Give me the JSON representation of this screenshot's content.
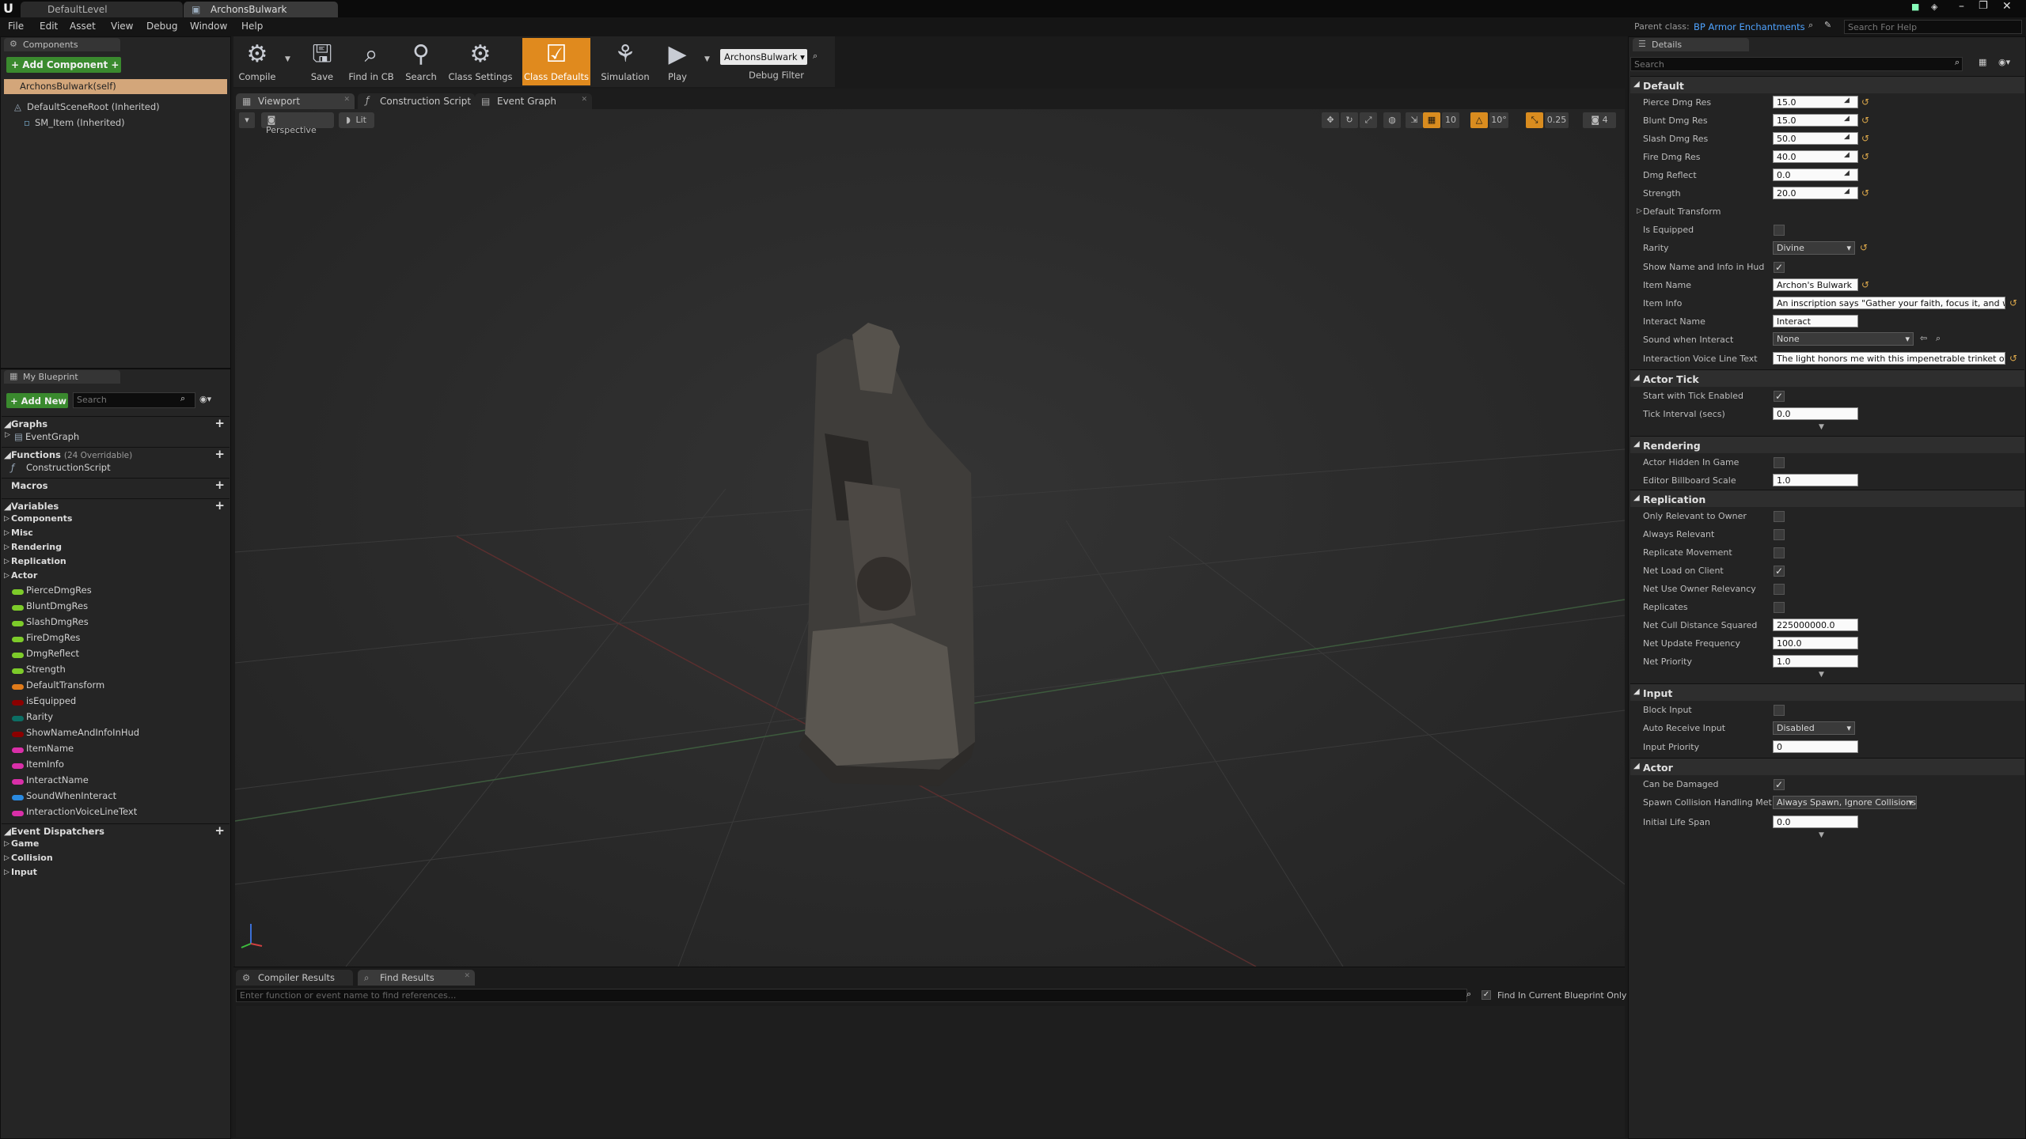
{
  "titlebar": {
    "tabs": [
      "DefaultLevel",
      "ArchonsBulwark"
    ]
  },
  "menubar": {
    "items": [
      "File",
      "Edit",
      "Asset",
      "View",
      "Debug",
      "Window",
      "Help"
    ],
    "parent_class_label": "Parent class:",
    "parent_class_value": "BP Armor Enchantments",
    "search_help_placeholder": "Search For Help"
  },
  "toolbar": {
    "buttons": [
      "Compile",
      "Save",
      "Find in CB",
      "Search",
      "Class Settings",
      "Class Defaults",
      "Simulation",
      "Play"
    ],
    "debug_object": "ArchonsBulwark",
    "debug_filter": "Debug Filter"
  },
  "components": {
    "tab": "Components",
    "add_button": "+ Add Component +",
    "self_item": "ArchonsBulwark(self)",
    "tree": [
      "DefaultSceneRoot (Inherited)",
      "SM_Item (Inherited)"
    ]
  },
  "my_blueprint": {
    "tab": "My Blueprint",
    "add_new": "+ Add New +",
    "search_placeholder": "Search",
    "graphs_label": "Graphs",
    "graphs": [
      "EventGraph"
    ],
    "functions_label": "Functions",
    "functions_count": "(24 Overridable)",
    "functions": [
      "ConstructionScript"
    ],
    "macros_label": "Macros",
    "variables_label": "Variables",
    "var_categories": [
      "Components",
      "Misc",
      "Rendering",
      "Replication",
      "Actor"
    ],
    "variables": [
      {
        "name": "PierceDmgRes",
        "color": "#7dcb2a"
      },
      {
        "name": "BluntDmgRes",
        "color": "#7dcb2a"
      },
      {
        "name": "SlashDmgRes",
        "color": "#7dcb2a"
      },
      {
        "name": "FireDmgRes",
        "color": "#7dcb2a"
      },
      {
        "name": "DmgReflect",
        "color": "#7dcb2a"
      },
      {
        "name": "Strength",
        "color": "#7dcb2a"
      },
      {
        "name": "DefaultTransform",
        "color": "#e07b1a"
      },
      {
        "name": "isEquipped",
        "color": "#8b0000"
      },
      {
        "name": "Rarity",
        "color": "#0c6e64"
      },
      {
        "name": "ShowNameAndInfoInHud",
        "color": "#8b0000"
      },
      {
        "name": "ItemName",
        "color": "#d92fa8"
      },
      {
        "name": "ItemInfo",
        "color": "#d92fa8"
      },
      {
        "name": "InteractName",
        "color": "#d92fa8"
      },
      {
        "name": "SoundWhenInteract",
        "color": "#2a8ae0"
      },
      {
        "name": "InteractionVoiceLineText",
        "color": "#d92fa8"
      }
    ],
    "dispatchers_label": "Event Dispatchers",
    "dispatcher_categories": [
      "Game",
      "Collision",
      "Input"
    ]
  },
  "editor_tabs": [
    "Viewport",
    "Construction Script",
    "Event Graph"
  ],
  "viewport": {
    "perspective": "Perspective",
    "lit": "Lit",
    "snap_grid": "10",
    "snap_rot": "10°",
    "snap_scale": "0.25",
    "cam_speed": "4"
  },
  "bottom": {
    "tabs": [
      "Compiler Results",
      "Find Results"
    ],
    "find_placeholder": "Enter function or event name to find references...",
    "find_current_only": "Find In Current Blueprint Only"
  },
  "details": {
    "tab": "Details",
    "search_placeholder": "Search",
    "default": {
      "title": "Default",
      "rows": [
        {
          "label": "Pierce Dmg Res",
          "value": "15.0"
        },
        {
          "label": "Blunt Dmg Res",
          "value": "15.0"
        },
        {
          "label": "Slash Dmg Res",
          "value": "50.0"
        },
        {
          "label": "Fire Dmg Res",
          "value": "40.0"
        },
        {
          "label": "Dmg Reflect",
          "value": "0.0"
        },
        {
          "label": "Strength",
          "value": "20.0"
        }
      ],
      "default_transform": "Default Transform",
      "is_equipped": "Is Equipped",
      "rarity_label": "Rarity",
      "rarity_value": "Divine",
      "show_name": "Show Name and Info in Hud",
      "item_name_label": "Item Name",
      "item_name_value": "Archon's Bulwark",
      "item_info_label": "Item Info",
      "item_info_value": "An inscription says \"Gather your faith, focus it, and when",
      "interact_name_label": "Interact Name",
      "interact_name_value": "Interact",
      "sound_label": "Sound when Interact",
      "sound_value": "None",
      "voice_label": "Interaction Voice Line Text",
      "voice_value": "The light honors me with this impenetrable trinket of def"
    },
    "actor_tick": {
      "title": "Actor Tick",
      "start_tick": "Start with Tick Enabled",
      "tick_interval_label": "Tick Interval (secs)",
      "tick_interval_value": "0.0"
    },
    "rendering": {
      "title": "Rendering",
      "hidden": "Actor Hidden In Game",
      "billboard_label": "Editor Billboard Scale",
      "billboard_value": "1.0"
    },
    "replication": {
      "title": "Replication",
      "checks": [
        "Only Relevant to Owner",
        "Always Relevant",
        "Replicate Movement",
        "Net Load on Client",
        "Net Use Owner Relevancy",
        "Replicates"
      ],
      "cull_label": "Net Cull Distance Squared",
      "cull_value": "225000000.0",
      "freq_label": "Net Update Frequency",
      "freq_value": "100.0",
      "priority_label": "Net Priority",
      "priority_value": "1.0"
    },
    "input": {
      "title": "Input",
      "block": "Block Input",
      "auto_label": "Auto Receive Input",
      "auto_value": "Disabled",
      "prio_label": "Input Priority",
      "prio_value": "0"
    },
    "actor": {
      "title": "Actor",
      "damaged": "Can be Damaged",
      "spawn_label": "Spawn Collision Handling Met",
      "spawn_value": "Always Spawn, Ignore Collisions",
      "life_label": "Initial Life Span",
      "life_value": "0.0"
    }
  }
}
